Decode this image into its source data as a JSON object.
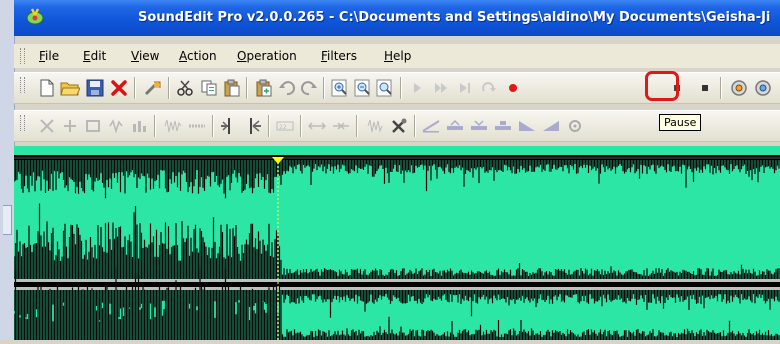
{
  "window": {
    "title": "SoundEdit Pro v2.0.0.265 - C:\\Documents and Settings\\aldino\\My Documents\\Geisha-Ji"
  },
  "menu": [
    {
      "id": "file",
      "label": "File",
      "mnemonic": "F",
      "rest": "ile"
    },
    {
      "id": "edit",
      "label": "Edit",
      "mnemonic": "E",
      "rest": "dit"
    },
    {
      "id": "view",
      "label": "View",
      "mnemonic": "V",
      "rest": "iew"
    },
    {
      "id": "action",
      "label": "Action",
      "mnemonic": "A",
      "rest": "ction"
    },
    {
      "id": "operation",
      "label": "Operation",
      "mnemonic": "O",
      "rest": "peration"
    },
    {
      "id": "filters",
      "label": "Filters",
      "mnemonic": "F",
      "rest": "ilters"
    },
    {
      "id": "help",
      "label": "Help",
      "mnemonic": "H",
      "rest": "elp"
    }
  ],
  "toolbar_main": [
    "new-file-icon",
    "open-folder-icon",
    "save-icon",
    "delete-icon",
    "properties-icon",
    "cut-icon",
    "copy-icon",
    "paste-icon",
    "paste-new-icon",
    "undo-icon",
    "redo-icon",
    "zoom-in-icon",
    "zoom-out-icon",
    "zoom-fit-icon",
    "play-icon",
    "play-selection-icon",
    "play-to-end-icon",
    "loop-icon",
    "record-icon",
    "pause-icon",
    "stop-icon",
    "effects-icon",
    "effects2-icon"
  ],
  "toolbar_edit": [
    "trim-icon",
    "insert-silence-icon",
    "mix-icon",
    "echo-icon",
    "equalizer-icon",
    "noise-icon",
    "silence-icon",
    "split-icon",
    "marker-icon",
    "normalize-icon",
    "stretch-icon",
    "compress-icon",
    "reverse-icon",
    "tools-icon",
    "fade-icon",
    "amplify-icon",
    "amplify2-icon",
    "amplify3-icon",
    "fade-out-icon",
    "fade-in-icon",
    "settings-icon"
  ],
  "tooltip": {
    "text": "Pause"
  },
  "colors": {
    "titlebar": "#1f66e5",
    "menu_bg": "#ece9d8",
    "waveform": "#2be6a4",
    "wave_bg": "#000000",
    "cursor": "#ffff00",
    "highlight": "#e01818"
  }
}
